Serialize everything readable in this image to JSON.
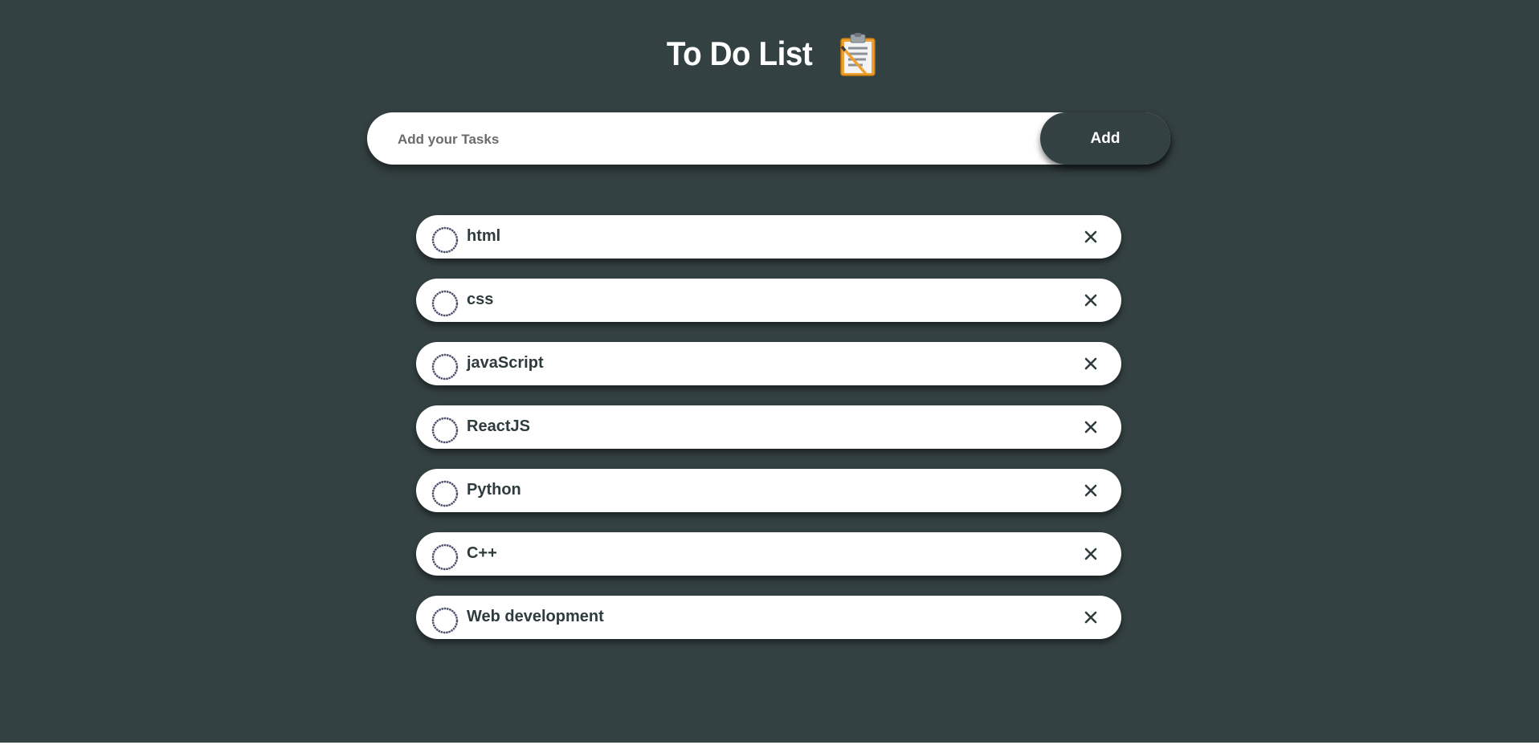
{
  "header": {
    "title": "To Do List",
    "icon": "clipboard-icon"
  },
  "input": {
    "placeholder": "Add your Tasks",
    "value": "",
    "add_label": "Add"
  },
  "tasks": [
    {
      "label": "html",
      "checked": false
    },
    {
      "label": "css",
      "checked": false
    },
    {
      "label": "javaScript",
      "checked": false
    },
    {
      "label": "ReactJS",
      "checked": false
    },
    {
      "label": "Python",
      "checked": false
    },
    {
      "label": "C++",
      "checked": false
    },
    {
      "label": "Web development",
      "checked": false
    }
  ],
  "colors": {
    "background": "#344142",
    "card": "#ffffff",
    "text": "#2f3c3d",
    "accent": "#f0a030"
  }
}
